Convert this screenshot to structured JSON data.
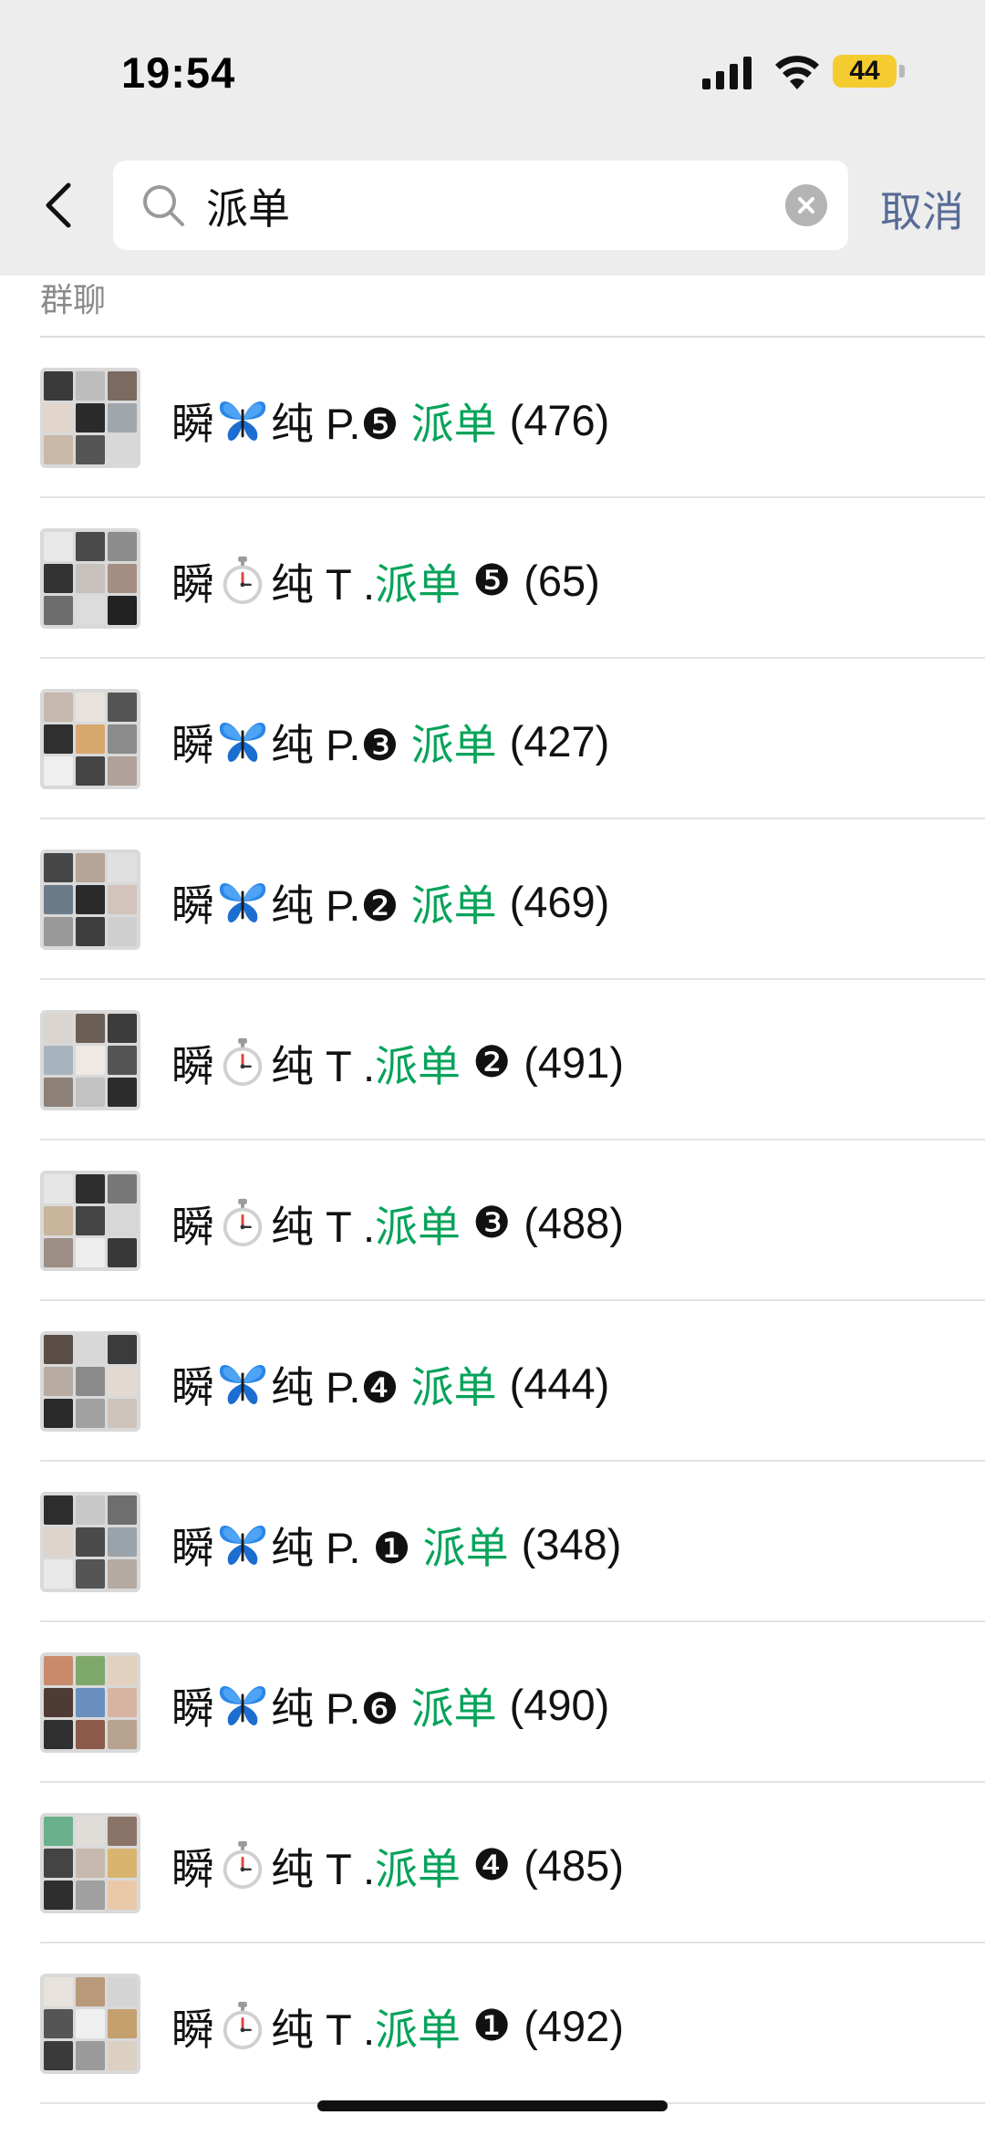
{
  "status_bar": {
    "time": "19:54",
    "battery": "44"
  },
  "search": {
    "query": "派单",
    "cancel_label": "取消"
  },
  "section": {
    "label": "群聊"
  },
  "colors": {
    "highlight": "#07a35a",
    "link": "#576b95",
    "battery": "#f5cc2f"
  },
  "results": [
    {
      "prefix": "瞬",
      "emoji": "butterfly-icon",
      "mid": "纯 P.❺ ",
      "highlight": "派单",
      "suffix": "",
      "count": "(476)"
    },
    {
      "prefix": "瞬",
      "emoji": "stopwatch-icon",
      "mid": "纯 T .",
      "highlight": "派单",
      "suffix": " ❺",
      "count": "(65)"
    },
    {
      "prefix": "瞬",
      "emoji": "butterfly-icon",
      "mid": "纯 P.❸ ",
      "highlight": "派单",
      "suffix": "",
      "count": "(427)"
    },
    {
      "prefix": "瞬",
      "emoji": "butterfly-icon",
      "mid": "纯 P.❷ ",
      "highlight": "派单",
      "suffix": "",
      "count": "(469)"
    },
    {
      "prefix": "瞬",
      "emoji": "stopwatch-icon",
      "mid": "纯 T .",
      "highlight": "派单",
      "suffix": " ❷",
      "count": "(491)"
    },
    {
      "prefix": "瞬",
      "emoji": "stopwatch-icon",
      "mid": "纯 T .",
      "highlight": "派单",
      "suffix": " ❸",
      "count": "(488)"
    },
    {
      "prefix": "瞬",
      "emoji": "butterfly-icon",
      "mid": "纯 P.❹ ",
      "highlight": "派单",
      "suffix": "",
      "count": "(444)"
    },
    {
      "prefix": "瞬",
      "emoji": "butterfly-icon",
      "mid": "纯 P. ❶ ",
      "highlight": "派单",
      "suffix": "",
      "count": "(348)"
    },
    {
      "prefix": "瞬",
      "emoji": "butterfly-icon",
      "mid": "纯 P.❻ ",
      "highlight": "派单",
      "suffix": "",
      "count": "(490)"
    },
    {
      "prefix": "瞬",
      "emoji": "stopwatch-icon",
      "mid": "纯 T .",
      "highlight": "派单",
      "suffix": " ❹",
      "count": "(485)"
    },
    {
      "prefix": "瞬",
      "emoji": "stopwatch-icon",
      "mid": "纯 T .",
      "highlight": "派单",
      "suffix": " ❶",
      "count": "(492)"
    }
  ]
}
